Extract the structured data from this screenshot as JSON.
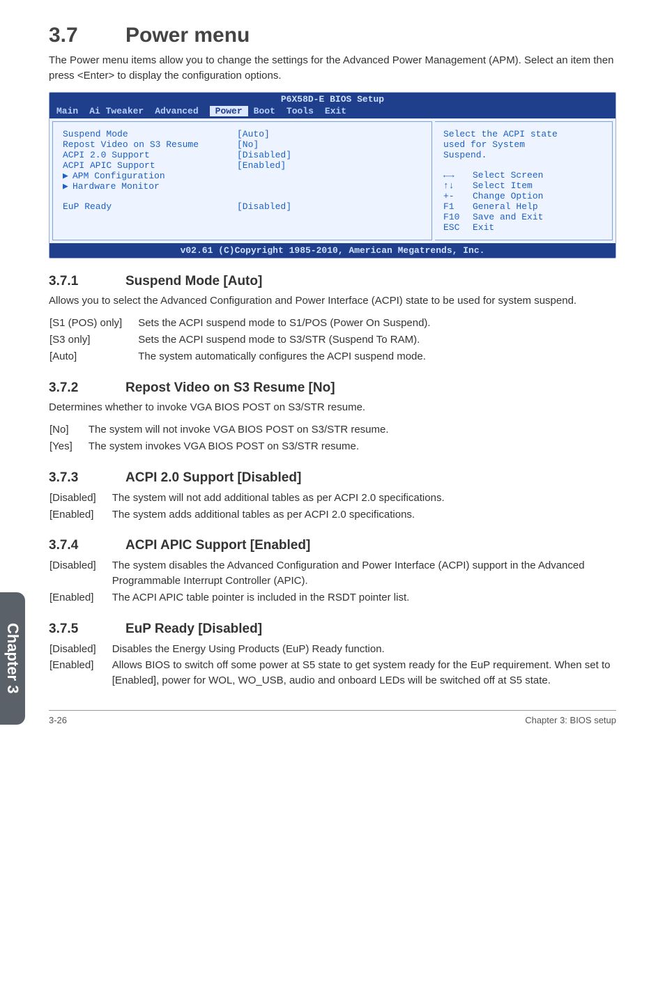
{
  "section": {
    "num": "3.7",
    "title": "Power menu",
    "intro": "The Power menu items allow you to change the settings for the Advanced Power Management (APM). Select an item then press <Enter> to display the configuration options."
  },
  "bios": {
    "top": "P6X58D-E BIOS Setup",
    "menu": {
      "main": "Main",
      "ai": "Ai Tweaker",
      "adv": "Advanced",
      "power": "Power",
      "boot": "Boot",
      "tools": "Tools",
      "exit": "Exit"
    },
    "rows": {
      "suspend": {
        "lbl": "Suspend Mode",
        "val": "[Auto]"
      },
      "repost": {
        "lbl": "Repost Video on S3 Resume",
        "val": "[No]"
      },
      "acpi20": {
        "lbl": "ACPI 2.0 Support",
        "val": "[Disabled]"
      },
      "apic": {
        "lbl": "ACPI APIC Support",
        "val": "[Enabled]"
      },
      "apm": {
        "lbl": "APM Configuration"
      },
      "hw": {
        "lbl": "Hardware Monitor"
      },
      "eup": {
        "lbl": "EuP Ready",
        "val": "[Disabled]"
      }
    },
    "help": {
      "desc1": "Select the ACPI state",
      "desc2": "used for System",
      "desc3": "Suspend.",
      "k1": {
        "k": "←→",
        "t": "Select Screen"
      },
      "k2": {
        "k": "↑↓",
        "t": "Select Item"
      },
      "k3": {
        "k": "+-",
        "t": "Change Option"
      },
      "k4": {
        "k": "F1",
        "t": "General Help"
      },
      "k5": {
        "k": "F10",
        "t": "Save and Exit"
      },
      "k6": {
        "k": "ESC",
        "t": "Exit"
      }
    },
    "footer": "v02.61 (C)Copyright 1985-2010, American Megatrends, Inc."
  },
  "sub": {
    "s1": {
      "num": "3.7.1",
      "title": "Suspend Mode [Auto]",
      "para": "Allows you to select the Advanced Configuration and Power Interface (ACPI) state to be used for system suspend.",
      "o1": {
        "k": "[S1 (POS) only]",
        "t": "Sets the ACPI suspend mode to S1/POS (Power On Suspend)."
      },
      "o2": {
        "k": "[S3 only]",
        "t": "Sets the ACPI suspend mode to S3/STR (Suspend To RAM)."
      },
      "o3": {
        "k": "[Auto]",
        "t": "The system automatically configures the ACPI suspend mode."
      }
    },
    "s2": {
      "num": "3.7.2",
      "title": "Repost Video on S3 Resume [No]",
      "para": "Determines whether to invoke VGA BIOS POST on S3/STR resume.",
      "o1": {
        "k": "[No]",
        "t": "The system will not invoke VGA BIOS POST on S3/STR resume."
      },
      "o2": {
        "k": "[Yes]",
        "t": "The system invokes VGA BIOS POST on S3/STR resume."
      }
    },
    "s3": {
      "num": "3.7.3",
      "title": "ACPI 2.0 Support [Disabled]",
      "o1": {
        "k": "[Disabled]",
        "t": "The system will not add additional tables as per ACPI 2.0 specifications."
      },
      "o2": {
        "k": "[Enabled]",
        "t": "The system adds additional tables as per ACPI 2.0 specifications."
      }
    },
    "s4": {
      "num": "3.7.4",
      "title": "ACPI APIC Support [Enabled]",
      "o1": {
        "k": "[Disabled]",
        "t": "The system disables the Advanced Configuration and Power Interface (ACPI) support in the Advanced Programmable Interrupt Controller (APIC)."
      },
      "o2": {
        "k": "[Enabled]",
        "t": "The ACPI APIC table pointer is included in the RSDT pointer list."
      }
    },
    "s5": {
      "num": "3.7.5",
      "title": "EuP Ready [Disabled]",
      "o1": {
        "k": "[Disabled]",
        "t": "Disables the Energy Using Products (EuP) Ready function."
      },
      "o2": {
        "k": "[Enabled]",
        "t": "Allows BIOS to switch off some power at S5 state to get system ready for the EuP requirement. When set to [Enabled], power for WOL, WO_USB, audio and onboard LEDs will be switched off at S5 state."
      }
    }
  },
  "sidetab": "Chapter 3",
  "footer": {
    "left": "3-26",
    "right": "Chapter 3: BIOS setup"
  }
}
